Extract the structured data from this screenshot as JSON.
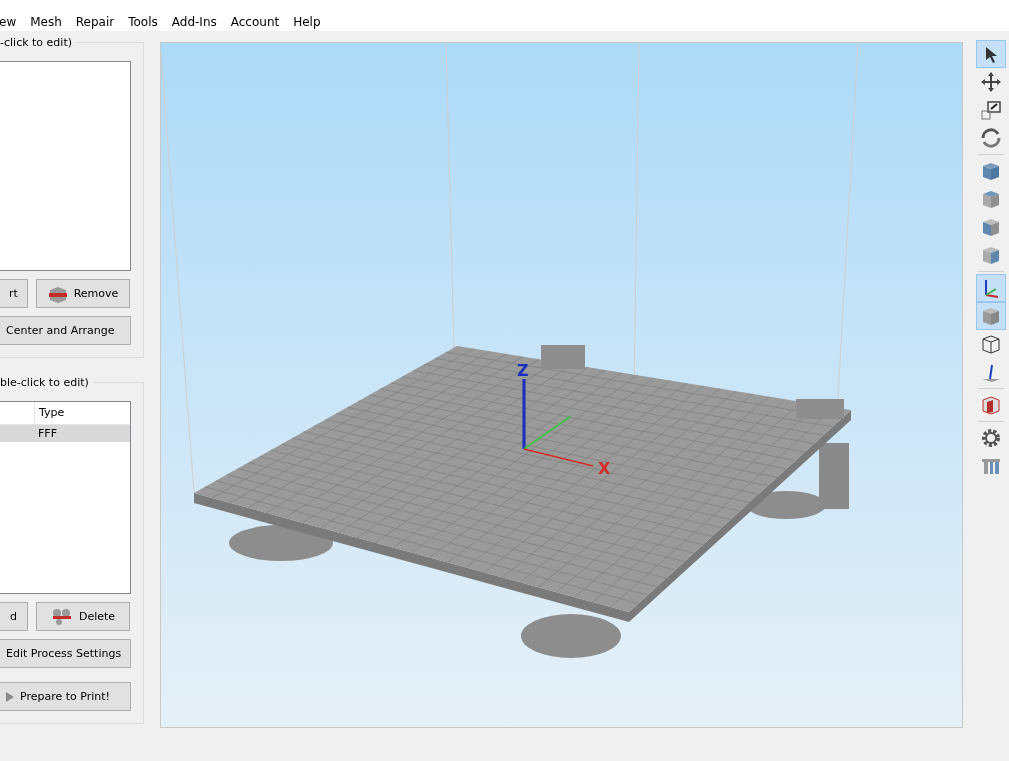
{
  "menu": [
    {
      "label": "ew"
    },
    {
      "label": "Mesh"
    },
    {
      "label": "Repair"
    },
    {
      "label": "Tools"
    },
    {
      "label": "Add-Ins"
    },
    {
      "label": "Account"
    },
    {
      "label": "Help"
    }
  ],
  "models_group": {
    "title": "-click to edit)",
    "buttons": [
      {
        "label": "rt",
        "kind": "import"
      },
      {
        "label": "Remove",
        "kind": "remove"
      }
    ],
    "wide_button": "Center and Arrange"
  },
  "processes_group": {
    "title": "ble-click to edit)",
    "columns": [
      "Type"
    ],
    "rows": [
      {
        "cells": [
          "FFF"
        ],
        "selected": true
      }
    ],
    "buttons": [
      {
        "label": "d",
        "kind": "add"
      },
      {
        "label": "Delete",
        "kind": "delete"
      }
    ],
    "wide_buttons": [
      {
        "label": "Edit Process Settings",
        "kind": "plain"
      },
      {
        "label": "Prepare to Print!",
        "kind": "print"
      }
    ]
  },
  "viewport": {
    "axis_labels": [
      "Z",
      "X"
    ]
  },
  "toolbar": [
    {
      "kind": "select",
      "selected": true
    },
    {
      "kind": "move",
      "selected": false
    },
    {
      "kind": "scale",
      "selected": false
    },
    {
      "kind": "rotate",
      "selected": false
    },
    {
      "kind": "sep"
    },
    {
      "kind": "cube-iso",
      "selected": false
    },
    {
      "kind": "cube-front",
      "selected": false
    },
    {
      "kind": "cube-top",
      "selected": false
    },
    {
      "kind": "cube-side",
      "selected": false
    },
    {
      "kind": "sep"
    },
    {
      "kind": "axes",
      "selected": true
    },
    {
      "kind": "cube-solid",
      "selected": true
    },
    {
      "kind": "wireframe",
      "selected": false
    },
    {
      "kind": "normal",
      "selected": false
    },
    {
      "kind": "sep"
    },
    {
      "kind": "section",
      "selected": false
    },
    {
      "kind": "sep"
    },
    {
      "kind": "gear",
      "selected": false
    },
    {
      "kind": "supports",
      "selected": false
    }
  ]
}
